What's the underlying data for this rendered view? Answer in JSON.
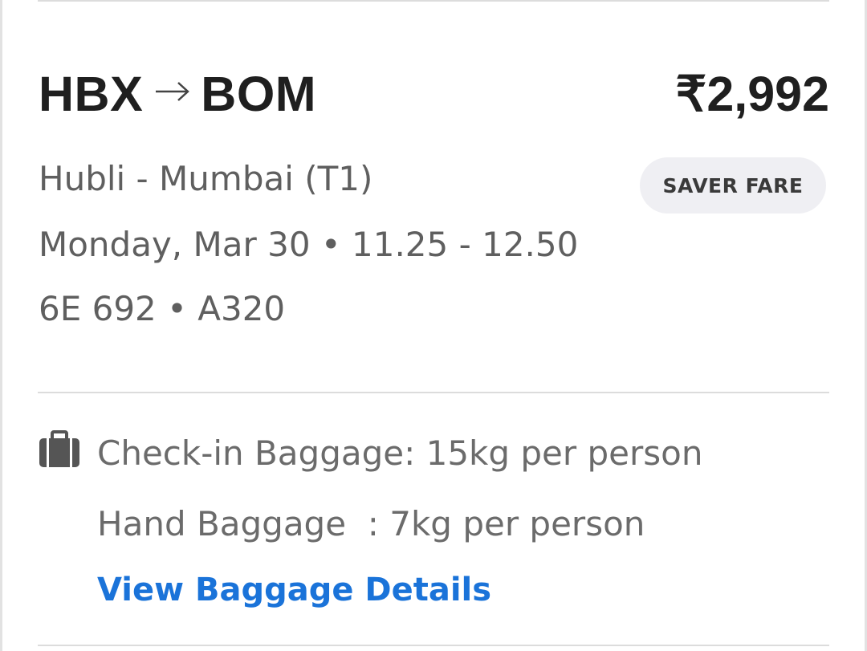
{
  "flight": {
    "origin": "HBX",
    "destination": "BOM",
    "price": "₹2,992",
    "route_text": "Hubli - Mumbai (T1)",
    "schedule": "Monday, Mar 30 • 11.25 - 12.50",
    "flight_info": "6E 692 • A320",
    "fare_badge": "SAVER FARE"
  },
  "baggage": {
    "checkin": "Check-in Baggage: 15kg per person",
    "hand": "Hand Baggage  : 7kg per person",
    "details_link": "View Baggage Details",
    "icon": "luggage-icon"
  },
  "colors": {
    "link": "#1a73d9",
    "badge_bg": "#efeff3"
  }
}
